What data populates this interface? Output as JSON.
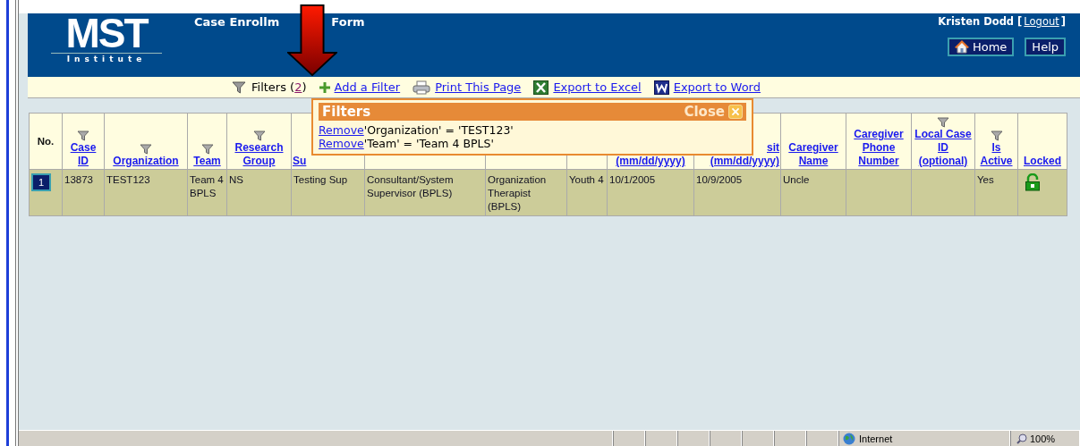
{
  "header": {
    "logo": "MST",
    "logo_subtitle": "Institute",
    "title_parts": [
      "Case Enrollm",
      "Form"
    ],
    "user": "Kristen Dodd [",
    "logout": "Logout",
    "user_end": "]",
    "buttons": [
      "Home",
      "Help"
    ]
  },
  "toolbar": {
    "filters_label": "Filters (",
    "filters_count": "2",
    "filters_end": ")",
    "links": [
      {
        "kind": "add",
        "label": "Add a Filter"
      },
      {
        "kind": "print",
        "label": "Print This Page"
      },
      {
        "kind": "excel",
        "label": "Export to Excel"
      },
      {
        "kind": "word",
        "label": "Export to Word"
      }
    ]
  },
  "filters_popup": {
    "title": "Filters",
    "close": "Close",
    "items": [
      {
        "action": "Remove",
        "text": "'Organization' = 'TEST123'"
      },
      {
        "action": "Remove",
        "text": "'Team' = 'Team 4 BPLS'"
      }
    ]
  },
  "table": {
    "columns": [
      {
        "kind": "text",
        "label": "No.",
        "filter": false
      },
      {
        "kind": "sort",
        "label": "Case ID",
        "filter": true
      },
      {
        "kind": "sort",
        "label": "Organization",
        "filter": true
      },
      {
        "kind": "sort",
        "label": "Team",
        "filter": true
      },
      {
        "kind": "sort",
        "label": "Research Group",
        "filter": true
      },
      {
        "kind": "sort",
        "label": "Su"
      },
      {},
      {},
      {},
      {
        "kind": "sort",
        "label": "(mm/dd/yyyy)"
      },
      {
        "kind": "sort",
        "label": "sit",
        "sub": "(mm/dd/yyyy)"
      },
      {
        "kind": "sort",
        "label": "Caregiver Name",
        "filter": false
      },
      {
        "kind": "sort",
        "label": "Caregiver Phone Number",
        "filter": false
      },
      {
        "kind": "sort",
        "label": "Local Case ID (optional)",
        "filter": true
      },
      {
        "kind": "sort",
        "label": "Is Active",
        "filter": true
      },
      {
        "kind": "sort",
        "label": "Locked",
        "filter": false
      }
    ],
    "rows": [
      {
        "locked": false,
        "cells": [
          "1",
          "13873",
          "TEST123",
          "Team 4 BPLS",
          "NS",
          "Testing Sup",
          "Consultant/System Supervisor (BPLS)",
          "Organization Therapist (BPLS)",
          "Youth 4",
          "10/1/2005",
          "10/9/2005",
          "Uncle",
          "",
          "",
          "Yes"
        ]
      }
    ]
  },
  "status_bar": {
    "zone": "Internet",
    "zoom": "100%"
  }
}
